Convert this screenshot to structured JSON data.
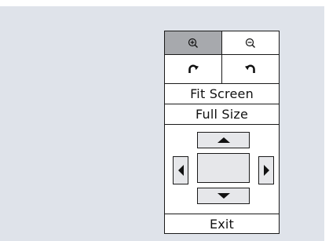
{
  "panel": {
    "zoom_in_icon": "zoom-in-icon",
    "zoom_out_icon": "zoom-out-icon",
    "rotate_right_icon": "rotate-clockwise-icon",
    "rotate_left_icon": "rotate-counterclockwise-icon",
    "fit_screen_label": "Fit Screen",
    "full_size_label": "Full Size",
    "exit_label": "Exit",
    "active_color": "#a7a9ad"
  },
  "pan": {
    "up_icon": "arrow-up-icon",
    "down_icon": "arrow-down-icon",
    "left_icon": "arrow-left-icon",
    "right_icon": "arrow-right-icon"
  }
}
